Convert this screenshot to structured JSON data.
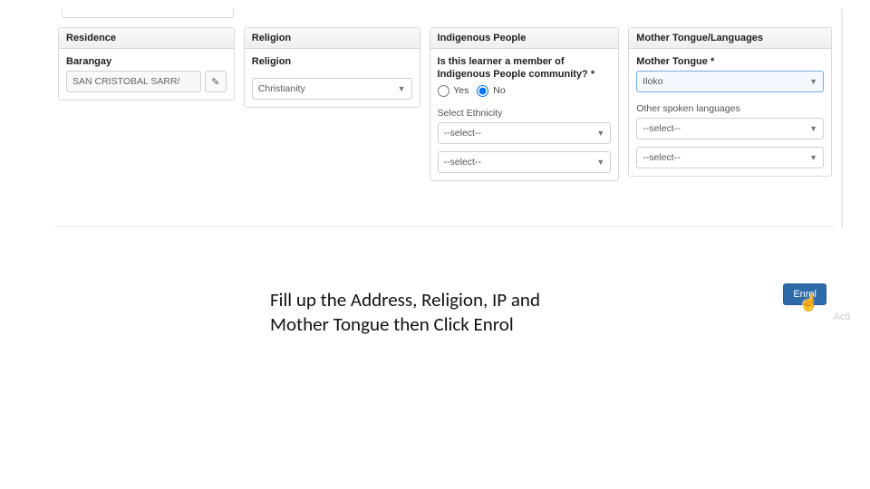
{
  "panels": {
    "residence": {
      "title": "Residence",
      "barangay_label": "Barangay",
      "barangay_value": "SAN CRISTOBAL SARR/"
    },
    "religion": {
      "title": "Religion",
      "religion_label": "Religion",
      "religion_value": "Christianity"
    },
    "ip": {
      "title": "Indigenous People",
      "question": "Is this learner a member of Indigenous People community? *",
      "yes_label": "Yes",
      "no_label": "No",
      "selected": "No",
      "select_ethnicity_label": "Select Ethnicity",
      "ethnicity1": "--select--",
      "ethnicity2": "--select--"
    },
    "mt": {
      "title": "Mother Tongue/Languages",
      "mother_tongue_label": "Mother Tongue *",
      "mother_tongue_value": "Iloko",
      "other_label": "Other spoken languages",
      "other1": "--select--",
      "other2": "--select--"
    }
  },
  "caption": {
    "line1": "Fill up the Address, Religion, IP and",
    "line2": "Mother Tongue then Click Enrol"
  },
  "enrol_label": "Enrol",
  "watermark": "Acti"
}
